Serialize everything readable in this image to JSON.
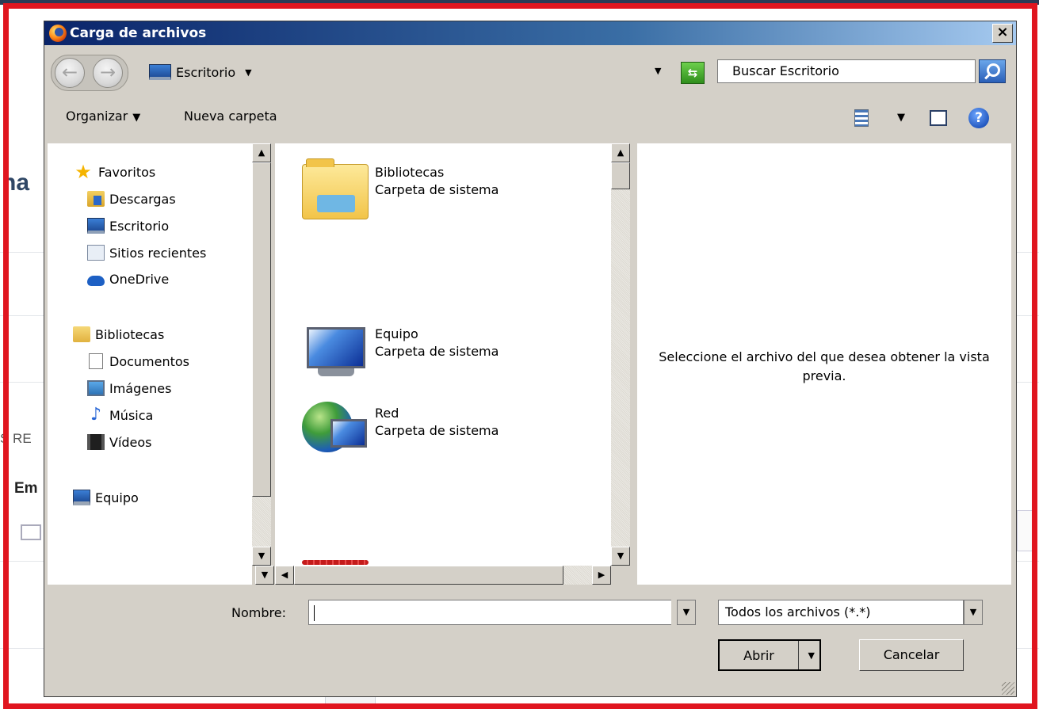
{
  "dialog": {
    "title": "Carga de archivos",
    "close_glyph": "×"
  },
  "address_bar": {
    "location": "Escritorio",
    "search_placeholder": "Buscar Escritorio"
  },
  "toolbar": {
    "organize_label": "Organizar",
    "new_folder_label": "Nueva carpeta"
  },
  "nav_pane": {
    "favorites_header": "Favoritos",
    "favorites": [
      {
        "label": "Descargas",
        "icon": "downloads-icon"
      },
      {
        "label": "Escritorio",
        "icon": "desktop-icon"
      },
      {
        "label": "Sitios recientes",
        "icon": "recent-places-icon"
      },
      {
        "label": "OneDrive",
        "icon": "onedrive-icon"
      }
    ],
    "libraries_header": "Bibliotecas",
    "libraries": [
      {
        "label": "Documentos",
        "icon": "documents-icon"
      },
      {
        "label": "Imágenes",
        "icon": "pictures-icon"
      },
      {
        "label": "Música",
        "icon": "music-icon"
      },
      {
        "label": "Vídeos",
        "icon": "videos-icon"
      }
    ],
    "computer": "Equipo"
  },
  "file_list": [
    {
      "name": "Bibliotecas",
      "type": "Carpeta de sistema",
      "icon": "libraries-folder-icon"
    },
    {
      "name": "Equipo",
      "type": "Carpeta de sistema",
      "icon": "computer-icon"
    },
    {
      "name": "Red",
      "type": "Carpeta de sistema",
      "icon": "network-icon"
    }
  ],
  "preview": {
    "message": "Seleccione el archivo del que desea obtener la vista previa."
  },
  "form": {
    "name_label": "Nombre:",
    "name_value": "",
    "file_type": "Todos los archivos (*.*)",
    "open_label": "Abrir",
    "cancel_label": "Cancelar"
  },
  "background_page": {
    "fragment_title": "na",
    "fragment_section": "S RE",
    "fragment_label": "Em"
  },
  "colors": {
    "annotation_border": "#e0151f",
    "dialog_face": "#d4d0c8",
    "titlebar_start": "#0a246a"
  }
}
